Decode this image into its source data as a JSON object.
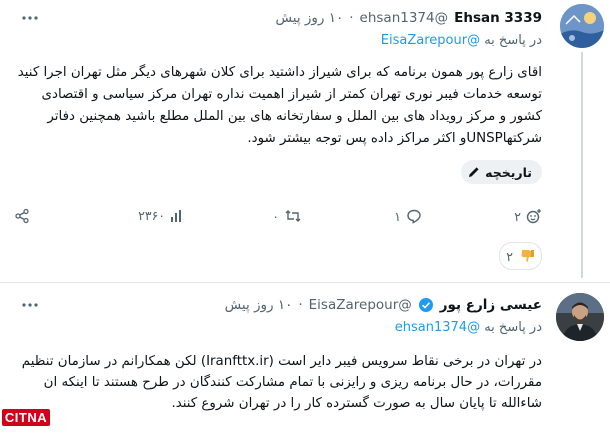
{
  "post1": {
    "display_name": "Ehsan 3339",
    "handle": "@ehsan1374",
    "time": "۱۰ روز پیش",
    "reply_prefix": "در پاسخ به",
    "reply_handle": "@EisaZarepour",
    "body": "اقای زارع پور همون برنامه که برای شیراز داشتید برای کلان شهرهای دیگر مثل تهران اجرا کنید توسعه خدمات فیبر نوری تهران کمتر از شیراز اهمیت نداره تهران مرکز سیاسی و اقتصادی کشور و مرکز رویداد های بین الملل و سفارتخانه های بین الملل مطلع باشید همچنین دفاتر شرکتهاUNSPو اکثر مراکز داده پس توجه بیشتر شود.",
    "history_label": "تاریخچه",
    "actions": {
      "reaction_count": "۲",
      "reply_count": "۱",
      "retweet_count": "۰",
      "views_count": "۲۳۶۰"
    },
    "dislike_count": "۲",
    "avatar_color": "#6e95c8"
  },
  "post2": {
    "display_name": "عیسی زارع پور",
    "handle": "@EisaZarepour",
    "time": "۱۰ روز پیش",
    "reply_prefix": "در پاسخ به",
    "reply_handle": "@ehsan1374",
    "body": "در تهران در برخی نقاط سرویس فیبر دایر است (Iranfttx.ir) لکن همکارانم در سازمان تنظیم مقررات، در حال برنامه ریزی و رایزنی با تمام مشارکت کنندگان در طرح هستند تا اینکه ان شاءالله تا پایان سال به صورت گسترده کار را در تهران شروع کنند.",
    "verified": true,
    "avatar_color": "#3a3f44"
  },
  "watermark": {
    "text": "CITNA"
  },
  "colors": {
    "link": "#1d9bf0",
    "muted": "#536471",
    "verified": "#1d9bf0"
  }
}
